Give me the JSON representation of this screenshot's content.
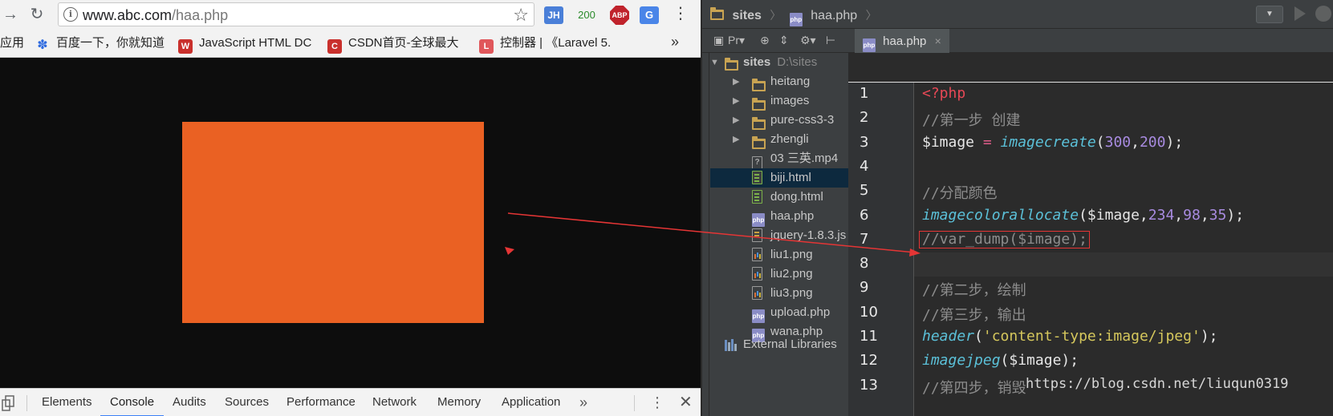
{
  "browser": {
    "nav": {
      "forward_glyph": "→",
      "reload_glyph": "↻"
    },
    "address": {
      "host": "www.abc.com",
      "path": "/haa.php"
    },
    "extensions": {
      "jh": "JH",
      "count": "200",
      "abp": "ABP",
      "translate": "G"
    },
    "bookmarks": [
      {
        "label": "应用"
      },
      {
        "label": "百度一下，你就知道",
        "color": "#2f6be0"
      },
      {
        "label": "JavaScript HTML DC",
        "color": "#c9302c"
      },
      {
        "label": "CSDN首页-全球最大",
        "color": "#c9302c"
      },
      {
        "label": "控制器 | 《Laravel 5.",
        "color": "#e0575b"
      }
    ],
    "bookmarks_more": "»",
    "rendered_image_color": "#ea6123",
    "devtools": {
      "tabs": [
        "Elements",
        "Console",
        "Audits",
        "Sources",
        "Performance",
        "Network",
        "Memory",
        "Application"
      ],
      "active_tab": "Console",
      "more": "»",
      "kebab": "⋮",
      "close": "✕"
    }
  },
  "ide": {
    "breadcrumb": {
      "root": "sites",
      "file": "haa.php"
    },
    "project_toolbar_label": "Pr▾",
    "editor_tab": {
      "label": "haa.php",
      "close": "×"
    },
    "tree": {
      "root": {
        "label": "sites",
        "path": "D:\\sites"
      },
      "items": [
        {
          "label": "heitang",
          "type": "folder"
        },
        {
          "label": "images",
          "type": "folder"
        },
        {
          "label": "pure-css3-3",
          "type": "folder"
        },
        {
          "label": "zhengli",
          "type": "folder"
        },
        {
          "label": "03 三英.mp4",
          "type": "unknown"
        },
        {
          "label": "biji.html",
          "type": "html",
          "selected": true
        },
        {
          "label": "dong.html",
          "type": "html"
        },
        {
          "label": "haa.php",
          "type": "php"
        },
        {
          "label": "jquery-1.8.3.js",
          "type": "js"
        },
        {
          "label": "liu1.png",
          "type": "image"
        },
        {
          "label": "liu2.png",
          "type": "image"
        },
        {
          "label": "liu3.png",
          "type": "image"
        },
        {
          "label": "upload.php",
          "type": "php"
        },
        {
          "label": "wana.php",
          "type": "php"
        }
      ],
      "external": "External Libraries"
    },
    "code_lines": [
      {
        "n": "1",
        "tokens": [
          [
            "tag",
            "<?php"
          ]
        ]
      },
      {
        "n": "2",
        "tokens": [
          [
            "cmt",
            "//第一步 创建"
          ]
        ]
      },
      {
        "n": "3",
        "tokens": [
          [
            "var",
            "$image "
          ],
          [
            "op",
            "="
          ],
          [
            "punc",
            " "
          ],
          [
            "fn",
            "imagecreate"
          ],
          [
            "punc",
            "("
          ],
          [
            "num",
            "300"
          ],
          [
            "punc",
            ","
          ],
          [
            "num",
            "200"
          ],
          [
            "punc",
            ");"
          ]
        ]
      },
      {
        "n": "4",
        "tokens": []
      },
      {
        "n": "5",
        "tokens": [
          [
            "cmt",
            "//分配颜色"
          ]
        ]
      },
      {
        "n": "6",
        "tokens": [
          [
            "fn",
            "imagecolorallocate"
          ],
          [
            "punc",
            "($image,"
          ],
          [
            "num",
            "234"
          ],
          [
            "punc",
            ","
          ],
          [
            "num",
            "98"
          ],
          [
            "punc",
            ","
          ],
          [
            "num",
            "35"
          ],
          [
            "punc",
            ");"
          ]
        ]
      },
      {
        "n": "7",
        "tokens": [
          [
            "cmt",
            "//var_dump($image);"
          ]
        ]
      },
      {
        "n": "8",
        "tokens": []
      },
      {
        "n": "9",
        "tokens": [
          [
            "cmt",
            "//第二步，绘制"
          ]
        ]
      },
      {
        "n": "10",
        "tokens": [
          [
            "cmt",
            "//第三步，输出"
          ]
        ]
      },
      {
        "n": "11",
        "tokens": [
          [
            "fn",
            "header"
          ],
          [
            "punc",
            "("
          ],
          [
            "str",
            "'content-type:image/jpeg'"
          ],
          [
            "punc",
            ");"
          ]
        ]
      },
      {
        "n": "12",
        "tokens": [
          [
            "fn",
            "imagejpeg"
          ],
          [
            "punc",
            "($image);"
          ]
        ]
      },
      {
        "n": "13",
        "tokens": [
          [
            "cmt",
            "//第四步，销毁"
          ]
        ]
      }
    ],
    "watermark": "https://blog.csdn.net/liuqun0319"
  },
  "colors": {
    "annotation_red": "#e53535"
  }
}
